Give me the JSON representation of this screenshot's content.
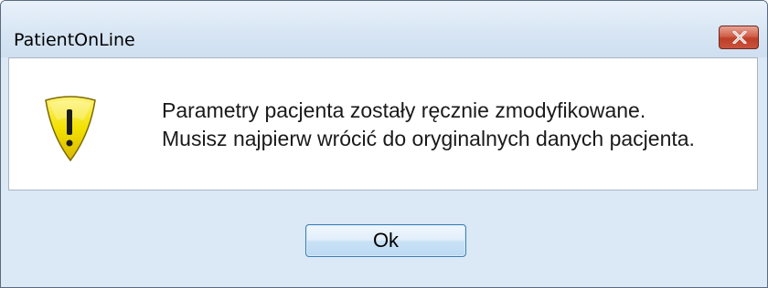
{
  "window": {
    "title": "PatientOnLine"
  },
  "titlebar": {
    "close_icon": "close-icon"
  },
  "message": {
    "icon": "warning-icon",
    "line1": "Parametry pacjenta zostały ręcznie zmodyfikowane.",
    "line2": "Musisz najpierw wrócić do oryginalnych danych pacjenta."
  },
  "buttons": {
    "ok_label": "Ok"
  },
  "colors": {
    "window_bg": "#dbe8f5",
    "close_button": "#c9533c",
    "warning_yellow": "#f5e400",
    "ok_button_border": "#3c7fb1"
  }
}
